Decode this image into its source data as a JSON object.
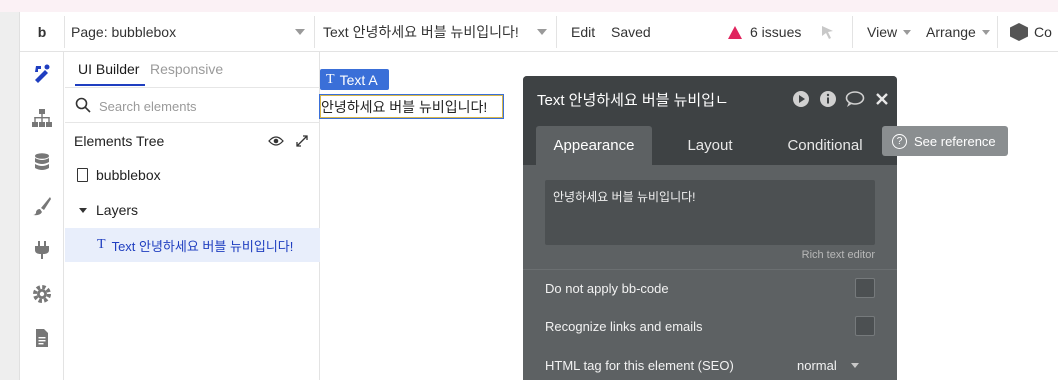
{
  "colors": {
    "accent": "#1f3ec0",
    "issues": "#e0245e",
    "editor_bg": "#5d6163",
    "editor_header": "#3e4244",
    "selection": "#3a6fd8"
  },
  "topbar": {
    "logo": "b",
    "page_selector": "Page: bubblebox",
    "element_selector": "Text 안녕하세요 버블 뉴비입니다!",
    "edit_label": "Edit",
    "saved_label": "Saved",
    "issues_label": "6 issues",
    "view_label": "View",
    "arrange_label": "Arrange",
    "cube_label": "Co"
  },
  "rail": {
    "icons": [
      "design-icon",
      "workflow-icon",
      "data-icon",
      "styles-icon",
      "plugins-icon",
      "settings-icon",
      "logs-icon"
    ]
  },
  "panel": {
    "tabs": {
      "ui_builder": "UI Builder",
      "responsive": "Responsive"
    },
    "search": {
      "placeholder": "Search elements",
      "value": ""
    },
    "tree_title": "Elements Tree",
    "items": {
      "page": "bubblebox",
      "layers": "Layers",
      "text_element": "Text 안녕하세요 버블 뉴비입니다!"
    }
  },
  "canvas": {
    "tag_label": "Text A",
    "text_content": "안녕하세요 버블 뉴비입니다!"
  },
  "editor": {
    "title": "Text 안녕하세요 버블 뉴비입ㄴ",
    "tabs": {
      "appearance": "Appearance",
      "layout": "Layout",
      "conditional": "Conditional"
    },
    "rich_text_value": "안녕하세요 버블 뉴비입니다!",
    "rich_text_label": "Rich text editor",
    "props": {
      "bbcode": "Do not apply bb-code",
      "links": "Recognize links and emails",
      "html_tag": "HTML tag for this element (SEO)",
      "html_tag_value": "normal"
    }
  },
  "see_reference": "See reference"
}
